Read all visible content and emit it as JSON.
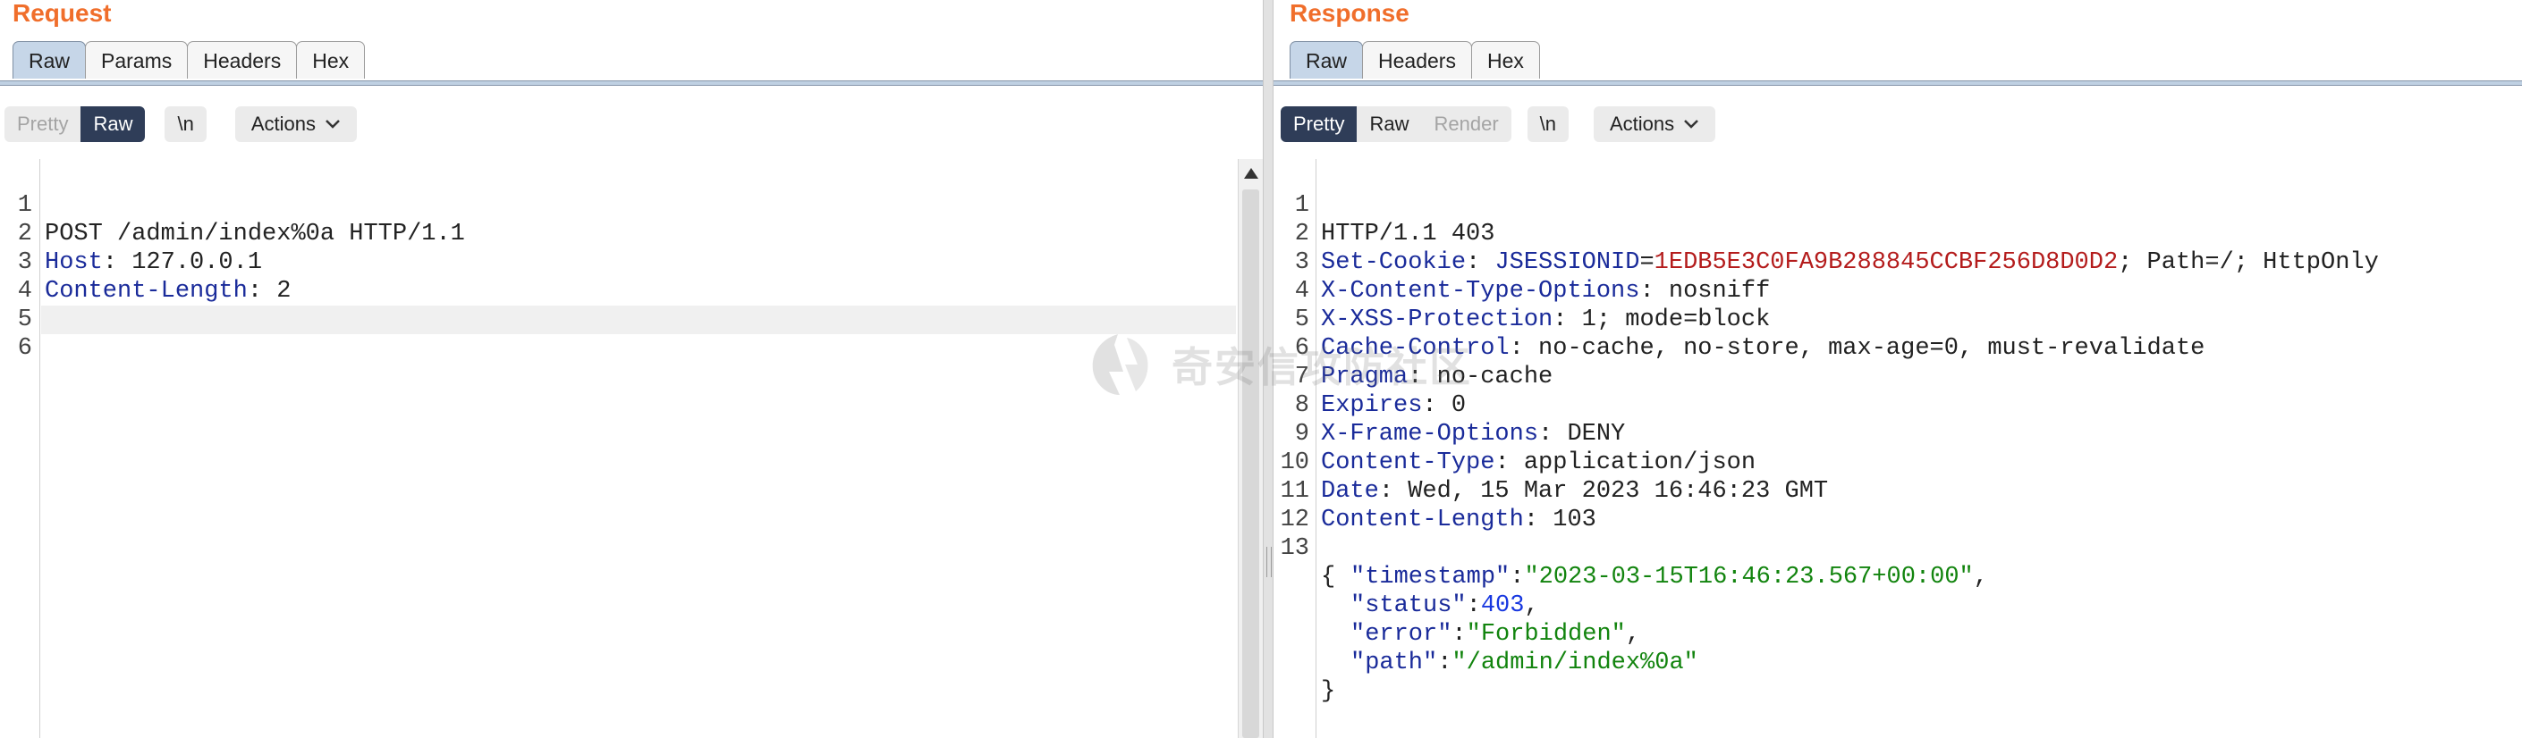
{
  "request": {
    "title": "Request",
    "tabs": [
      "Raw",
      "Params",
      "Headers",
      "Hex"
    ],
    "active_tab": "Raw",
    "view_buttons": {
      "pretty": "Pretty",
      "raw": "Raw"
    },
    "newline_button": "\\n",
    "actions_button": "Actions",
    "line_numbers": [
      "1",
      "2",
      "3",
      "4",
      "5",
      "6"
    ],
    "lines": {
      "l1": "POST /admin/index%0a HTTP/1.1",
      "l2_key": "Host",
      "l2_val": ": 127.0.0.1",
      "l3_key": "Content-Length",
      "l3_val": ": 2"
    }
  },
  "response": {
    "title": "Response",
    "tabs": [
      "Raw",
      "Headers",
      "Hex"
    ],
    "active_tab": "Raw",
    "view_buttons": {
      "pretty": "Pretty",
      "raw": "Raw",
      "render": "Render"
    },
    "newline_button": "\\n",
    "actions_button": "Actions",
    "line_numbers": [
      "1",
      "2",
      "3",
      "4",
      "5",
      "6",
      "7",
      "8",
      "9",
      "10",
      "11",
      "12",
      "13"
    ],
    "lines": {
      "l1": "HTTP/1.1 403",
      "l2_key": "Set-Cookie",
      "l2_colon": ": ",
      "l2_cname": "JSESSIONID",
      "l2_eq": "=",
      "l2_cval": "1EDB5E3C0FA9B288845CCBF256D8D0D2",
      "l2_rest": "; Path=/; HttpOnly",
      "l3_key": "X-Content-Type-Options",
      "l3_val": ": nosniff",
      "l4_key": "X-XSS-Protection",
      "l4_val": ": 1; mode=block",
      "l5_key": "Cache-Control",
      "l5_val": ": no-cache, no-store, max-age=0, must-revalidate",
      "l6_key": "Pragma",
      "l6_val": ": no-cache",
      "l7_key": "Expires",
      "l7_val": ": 0",
      "l8_key": "X-Frame-Options",
      "l8_val": ": DENY",
      "l9_key": "Content-Type",
      "l9_val": ": application/json",
      "l10_key": "Date",
      "l10_val": ": Wed, 15 Mar 2023 16:46:23 GMT",
      "l11_key": "Content-Length",
      "l11_val": ": 103",
      "l13": "{",
      "j1_key": "\"timestamp\"",
      "j1_sep": ":",
      "j1_val": "\"2023-03-15T16:46:23.567+00:00\"",
      "j1_end": ",",
      "j2_key": "\"status\"",
      "j2_sep": ":",
      "j2_val": "403",
      "j2_end": ",",
      "j3_key": "\"error\"",
      "j3_sep": ":",
      "j3_val": "\"Forbidden\"",
      "j3_end": ",",
      "j4_key": "\"path\"",
      "j4_sep": ":",
      "j4_val": "\"/admin/index%0a\"",
      "close": "}"
    }
  },
  "watermark": "奇安信攻防社区",
  "colors": {
    "title_orange": "#f06e2b",
    "active_toggle": "#2f3d58",
    "header_key": "#1a2b9a",
    "cookie_value": "#b41c1c",
    "json_string": "#12840e",
    "json_number": "#1838e0"
  }
}
